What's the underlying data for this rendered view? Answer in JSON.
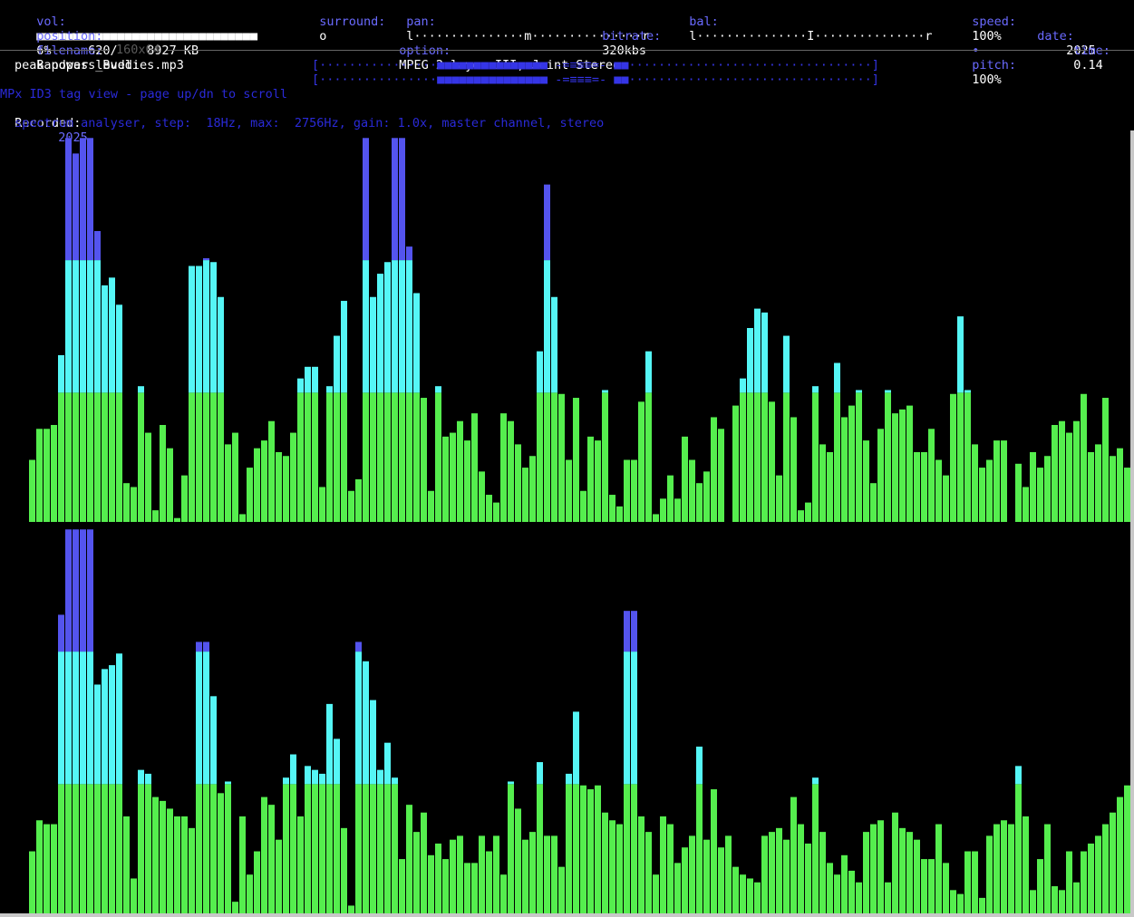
{
  "header": {
    "vol_label": "vol:",
    "vol_bar": "■■■■■■■■■■■■■■■■■■■■■■■■■■■■■■",
    "surround_label": "surround:",
    "surround_value": "o",
    "pan_label": "pan:",
    "pan_bar": "l···············m···············r",
    "bal_label": "bal:",
    "bal_bar": "l···············I···············r",
    "speed_label": "speed:",
    "speed_value": "100%",
    "speed_sep": "•",
    "pitch_label": "pitch:",
    "pitch_value": "100%",
    "position_label": "position:",
    "position_value": "6%     620/    8927 KB",
    "bitrate_label": "bitrate:",
    "bitrate_value": "320kbs",
    "date_label": "date:",
    "date_value": "2025",
    "filename_label": "filename:",
    "filename_value": "Bandpass_Buddies.mp3",
    "option_label": "option:",
    "option_value": "MPEG 2 layer III, Joint Stereo",
    "time_label": "time:",
    "time_value": "0.14"
  },
  "resolution": "160x64",
  "peak": {
    "label": "peak power level:",
    "left_bar": "[················■■■■■■■■■■■■■■■ -=≡≡≡=- ■■·································]",
    "right_bar": "[················■■■■■■■■■■■■■■■ -=≡≡≡=- ■■·································]"
  },
  "id3": {
    "title": "MPx ID3 tag view - page up/dn to scroll",
    "recorded_label": "Recorded:",
    "recorded_value": "2025"
  },
  "spectrum_info": "spectrum analyser, step:  18Hz, max:  2756Hz, gain: 1.0x, master channel, stereo",
  "colors": {
    "green": "#55ee4e",
    "cyan": "#55f6f6",
    "blue": "#5454ee",
    "label": "#6a6aff"
  },
  "spectrum": {
    "channels": [
      {
        "name": "left",
        "levels": [
          0.16,
          0.24,
          0.24,
          0.25,
          0.43,
          0.99,
          0.95,
          0.99,
          0.99,
          0.75,
          0.61,
          0.63,
          0.56,
          0.1,
          0.09,
          0.35,
          0.23,
          0.03,
          0.25,
          0.19,
          0.01,
          0.12,
          0.66,
          0.66,
          0.68,
          0.67,
          0.58,
          0.2,
          0.23,
          0.02,
          0.14,
          0.19,
          0.21,
          0.26,
          0.18,
          0.17,
          0.23,
          0.37,
          0.4,
          0.4,
          0.09,
          0.35,
          0.48,
          0.57,
          0.08,
          0.11,
          0.99,
          0.58,
          0.64,
          0.67,
          0.99,
          0.99,
          0.71,
          0.59,
          0.32,
          0.08,
          0.35,
          0.22,
          0.23,
          0.26,
          0.21,
          0.28,
          0.13,
          0.07,
          0.05,
          0.28,
          0.26,
          0.2,
          0.14,
          0.17,
          0.44,
          0.87,
          0.58,
          0.33,
          0.16,
          0.32,
          0.08,
          0.22,
          0.21,
          0.34,
          0.07,
          0.04,
          0.16,
          0.16,
          0.31,
          0.44,
          0.02,
          0.06,
          0.12,
          0.06,
          0.22,
          0.16,
          0.1,
          0.13,
          0.27,
          0.24,
          0.0,
          0.3,
          0.37,
          0.5,
          0.55,
          0.54,
          0.31,
          0.12,
          0.48,
          0.27,
          0.03,
          0.05,
          0.35,
          0.2,
          0.18,
          0.41,
          0.27,
          0.3,
          0.34,
          0.21,
          0.1,
          0.24,
          0.34,
          0.28,
          0.29,
          0.3,
          0.18,
          0.18,
          0.24,
          0.16,
          0.12,
          0.33,
          0.53,
          0.34,
          0.2,
          0.14,
          0.16,
          0.21,
          0.21,
          0.0,
          0.15,
          0.09,
          0.18,
          0.14,
          0.17,
          0.25,
          0.26,
          0.23,
          0.26,
          0.33,
          0.18,
          0.2,
          0.32,
          0.17,
          0.19,
          0.14,
          0.18,
          0.1,
          0.52,
          0.22,
          0.23,
          0.13,
          0.07,
          0.18,
          0.37,
          0.14,
          0.27,
          0.26,
          0.35,
          0.08,
          0.34,
          0.67,
          0.39
        ]
      },
      {
        "name": "right",
        "levels": [
          0.16,
          0.24,
          0.23,
          0.23,
          0.77,
          0.99,
          0.99,
          0.99,
          0.99,
          0.59,
          0.63,
          0.64,
          0.67,
          0.25,
          0.09,
          0.37,
          0.36,
          0.3,
          0.29,
          0.27,
          0.25,
          0.25,
          0.22,
          0.7,
          0.7,
          0.56,
          0.31,
          0.34,
          0.03,
          0.25,
          0.1,
          0.16,
          0.3,
          0.28,
          0.19,
          0.35,
          0.41,
          0.25,
          0.38,
          0.37,
          0.36,
          0.54,
          0.45,
          0.22,
          0.02,
          0.7,
          0.65,
          0.55,
          0.37,
          0.44,
          0.35,
          0.14,
          0.28,
          0.21,
          0.26,
          0.15,
          0.18,
          0.14,
          0.19,
          0.2,
          0.13,
          0.13,
          0.2,
          0.16,
          0.2,
          0.1,
          0.34,
          0.27,
          0.19,
          0.21,
          0.39,
          0.2,
          0.2,
          0.12,
          0.36,
          0.52,
          0.33,
          0.32,
          0.33,
          0.26,
          0.24,
          0.23,
          0.78,
          0.78,
          0.25,
          0.21,
          0.1,
          0.25,
          0.23,
          0.13,
          0.17,
          0.2,
          0.43,
          0.19,
          0.32,
          0.17,
          0.2,
          0.12,
          0.1,
          0.09,
          0.08,
          0.2,
          0.21,
          0.22,
          0.19,
          0.3,
          0.23,
          0.18,
          0.35,
          0.21,
          0.13,
          0.1,
          0.15,
          0.11,
          0.08,
          0.21,
          0.23,
          0.24,
          0.08,
          0.26,
          0.22,
          0.21,
          0.19,
          0.14,
          0.14,
          0.23,
          0.13,
          0.06,
          0.05,
          0.16,
          0.16,
          0.04,
          0.2,
          0.23,
          0.24,
          0.23,
          0.38,
          0.25,
          0.06,
          0.14,
          0.23,
          0.07,
          0.06,
          0.16,
          0.08,
          0.16,
          0.18,
          0.2,
          0.23,
          0.26,
          0.3,
          0.33,
          0.16,
          0.27,
          0.28,
          0.31,
          0.54,
          0.23,
          0.1,
          0.09,
          0.17,
          0.29,
          0.32,
          0.26,
          0.21,
          0.33,
          0.21,
          0.36,
          0.38
        ]
      }
    ]
  }
}
